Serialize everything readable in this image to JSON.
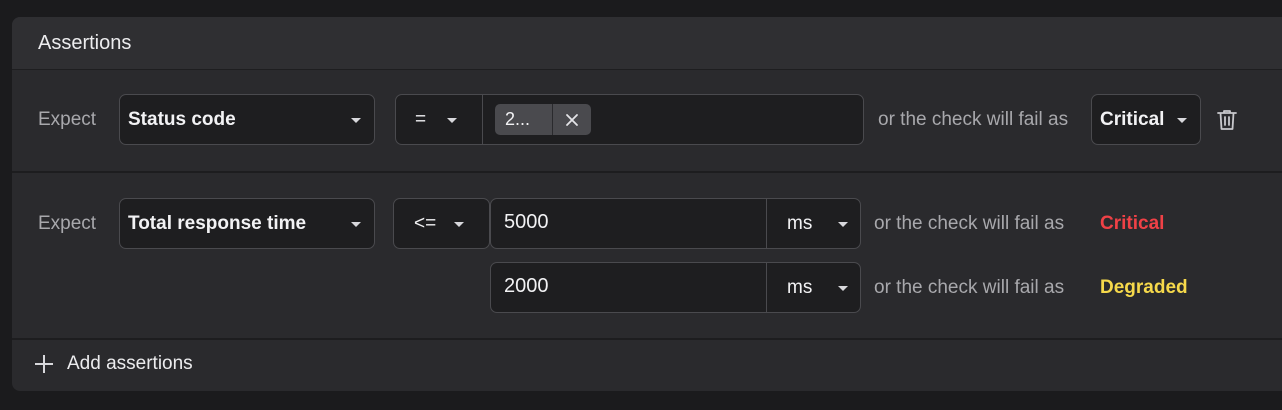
{
  "panel": {
    "title": "Assertions",
    "add_label": "Add assertions"
  },
  "assertion1": {
    "expect_label": "Expect",
    "property": "Status code",
    "operator": "=",
    "chip_value": "2...",
    "fail_text": "or the check will fail as",
    "severity": "Critical"
  },
  "assertion2": {
    "expect_label": "Expect",
    "property": "Total response time",
    "operator": "<=",
    "critical": {
      "value": "5000",
      "unit": "ms",
      "fail_text": "or the check will fail as",
      "severity": "Critical"
    },
    "degraded": {
      "value": "2000",
      "unit": "ms",
      "fail_text": "or the check will fail as",
      "severity": "Degraded"
    }
  },
  "colors": {
    "critical": "#ef4146",
    "degraded": "#f6d94b",
    "background": "#1b1b1d",
    "panel": "#2a2a2d"
  },
  "icons": [
    "chevron-down-icon",
    "close-icon",
    "trash-icon",
    "plus-icon"
  ]
}
